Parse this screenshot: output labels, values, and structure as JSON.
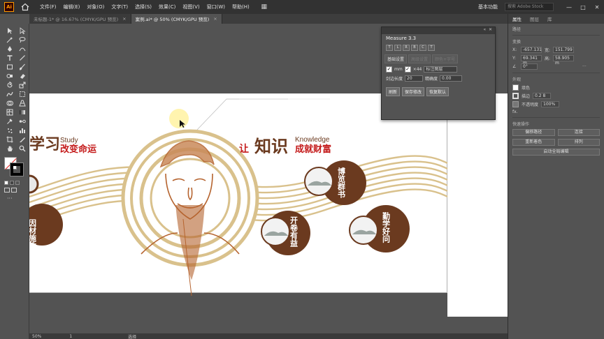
{
  "app": {
    "logo": "Ai"
  },
  "menu": [
    "文件(F)",
    "编辑(E)",
    "对象(O)",
    "文字(T)",
    "选择(S)",
    "效果(C)",
    "视图(V)",
    "窗口(W)",
    "帮助(H)"
  ],
  "menubar_right": {
    "workspace": "基本功能",
    "stock_placeholder": "搜索 Adobe Stock"
  },
  "tabs": [
    {
      "label": "未标题-1* @ 16.67% (CMYK/GPU 预览)",
      "close": "×"
    },
    {
      "label": "案例.ai* @ 50% (CMYK/GPU 预览)",
      "close": "×"
    }
  ],
  "measure": {
    "title": "Measure 3.3",
    "tool_buttons": [
      "T",
      "L",
      "R",
      "B",
      "C",
      "T"
    ],
    "tabs": [
      "基础设置",
      "高级设置",
      "颜色+字号"
    ],
    "check1_label": "mm",
    "check2_label": "×44",
    "layer_value": "标注图层",
    "length_label": "剑边长度",
    "length_value": "20",
    "precision_label": "精确度",
    "precision_value": "0.00",
    "buttons": [
      "刷新",
      "保存修改",
      "恢复默认"
    ]
  },
  "right_panel": {
    "tabs": [
      "属性",
      "图层",
      "库"
    ],
    "section_path": "路径",
    "section_transform": "变换",
    "x_label": "X:",
    "x_value": "-657.131",
    "y_label": "Y:",
    "y_value": "69.341 m",
    "w_label": "宽:",
    "w_value": "151.799",
    "h_label": "高:",
    "h_value": "58.905 m",
    "angle_value": "0°",
    "section_appearance": "外观",
    "fill_label": "填色",
    "stroke_label": "描边",
    "stroke_value": "0.2 8",
    "opacity_label": "不透明度",
    "opacity_value": "100%",
    "fx_label": "fx.",
    "section_quick": "快速操作",
    "quick_buttons": [
      "偏移路径",
      "连接",
      "重新着色",
      "排列"
    ],
    "start_global_edit": "启动全局编辑"
  },
  "status": {
    "zoom": "50%",
    "page": "1",
    "mode": "选择"
  },
  "artwork": {
    "left_phrase_big": "学习",
    "left_phrase_en": "Study",
    "left_phrase_red": "改变命运",
    "right_phrase_prefix": "让",
    "right_phrase_big": "知识",
    "right_phrase_en": "Knowledge",
    "right_phrase_red": "成就财富",
    "circle1": "因材施教",
    "circle2": "开卷有益",
    "circle3": "博览群书",
    "circle4": "勤学好问",
    "colors": {
      "brown": "#6b3a1f",
      "gold": "#d9c18c",
      "red": "#c41a1a"
    }
  }
}
